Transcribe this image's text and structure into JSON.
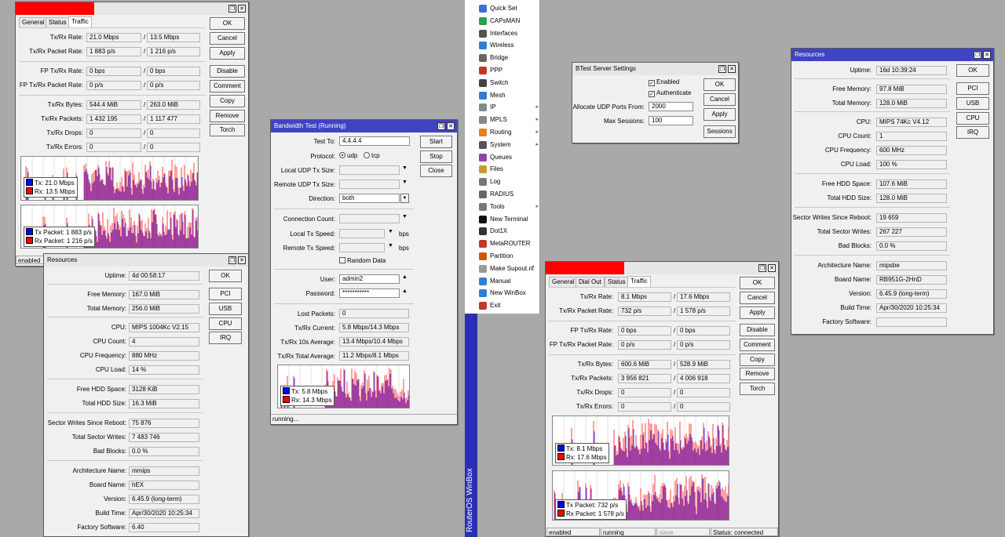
{
  "traffic1": {
    "tabs": [
      "General",
      "Status",
      "Traffic"
    ],
    "rows": [
      {
        "label": "Tx/Rx Rate:",
        "a": "21.0 Mbps",
        "b": "13.5 Mbps"
      },
      {
        "label": "Tx/Rx Packet Rate:",
        "a": "1 883 p/s",
        "b": "1 216 p/s"
      },
      {
        "label": "FP Tx/Rx Rate:",
        "a": "0 bps",
        "b": "0 bps"
      },
      {
        "label": "FP Tx/Rx Packet Rate:",
        "a": "0 p/s",
        "b": "0 p/s"
      },
      {
        "label": "Tx/Rx Bytes:",
        "a": "544.4 MiB",
        "b": "263.0 MiB"
      },
      {
        "label": "Tx/Rx Packets:",
        "a": "1 432 195",
        "b": "1 117 477"
      },
      {
        "label": "Tx/Rx Drops:",
        "a": "0",
        "b": "0"
      },
      {
        "label": "Tx/Rx Errors:",
        "a": "0",
        "b": "0"
      }
    ],
    "buttons": [
      "OK",
      "Cancel",
      "Apply",
      "Disable",
      "Comment",
      "Copy",
      "Remove",
      "Torch"
    ],
    "legend_rate": [
      "Tx:  21.0 Mbps",
      "Rx:  13.5 Mbps"
    ],
    "legend_pkt": [
      "Tx Packet:  1 883 p/s",
      "Rx Packet:  1 216 p/s"
    ],
    "status": "enabled"
  },
  "res1": {
    "title": "Resources",
    "fields": [
      {
        "label": "Uptime:",
        "value": "4d 00:58:17"
      },
      {
        "label": "Free Memory:",
        "value": "167.0 MiB"
      },
      {
        "label": "Total Memory:",
        "value": "256.0 MiB"
      },
      {
        "label": "CPU:",
        "value": "MIPS 1004Kc V2.15"
      },
      {
        "label": "CPU Count:",
        "value": "4"
      },
      {
        "label": "CPU Frequency:",
        "value": "880 MHz"
      },
      {
        "label": "CPU Load:",
        "value": "14 %"
      },
      {
        "label": "Free HDD Space:",
        "value": "3128 KiB"
      },
      {
        "label": "Total HDD Size:",
        "value": "16.3 MiB"
      },
      {
        "label": "Sector Writes Since Reboot:",
        "value": "75 876"
      },
      {
        "label": "Total Sector Writes:",
        "value": "7 483 746"
      },
      {
        "label": "Bad Blocks:",
        "value": "0.0 %"
      },
      {
        "label": "Architecture Name:",
        "value": "mmips"
      },
      {
        "label": "Board Name:",
        "value": "hEX"
      },
      {
        "label": "Version:",
        "value": "6.45.9 (long-term)"
      },
      {
        "label": "Build Time:",
        "value": "Apr/30/2020 10:25:34"
      },
      {
        "label": "Factory Software:",
        "value": "6.40"
      }
    ],
    "buttons": [
      "OK",
      "PCI",
      "USB",
      "CPU",
      "IRQ"
    ]
  },
  "bw": {
    "title": "Bandwidth Test (Running)",
    "test_to_label": "Test To:",
    "test_to": "4.4.4.4",
    "protocol_label": "Protocol:",
    "udp": "udp",
    "tcp": "tcp",
    "local_udp_label": "Local UDP Tx Size:",
    "remote_udp_label": "Remote UDP Tx Size:",
    "direction_label": "Direction:",
    "direction": "both",
    "conn_count_label": "Connection Count:",
    "local_tx_label": "Local Tx Speed:",
    "remote_tx_label": "Remote Tx Speed:",
    "unit": "bps",
    "random_label": "Random Data",
    "user_label": "User:",
    "user": "admin2",
    "password_label": "Password:",
    "password": "***********",
    "lost_label": "Lost Packets:",
    "lost": "0",
    "current_label": "Tx/Rx Current:",
    "current": "5.8 Mbps/14.3 Mbps",
    "avg10_label": "Tx/Rx 10s Average:",
    "avg10": "13.4 Mbps/10.4 Mbps",
    "total_label": "Tx/Rx Total Average:",
    "total": "11.2 Mbps/8.1 Mbps",
    "buttons": [
      "Start",
      "Stop",
      "Close"
    ],
    "legend": [
      "Tx:  5.8 Mbps",
      "Rx:  14.3 Mbps"
    ],
    "status": "running..."
  },
  "menu": {
    "items": [
      {
        "label": "Quick Set",
        "icon": "quick-set-icon",
        "sub": false
      },
      {
        "label": "CAPsMAN",
        "icon": "capsman-icon",
        "sub": false
      },
      {
        "label": "Interfaces",
        "icon": "interfaces-icon",
        "sub": false
      },
      {
        "label": "Wireless",
        "icon": "wireless-icon",
        "sub": false
      },
      {
        "label": "Bridge",
        "icon": "bridge-icon",
        "sub": false
      },
      {
        "label": "PPP",
        "icon": "ppp-icon",
        "sub": false
      },
      {
        "label": "Switch",
        "icon": "switch-icon",
        "sub": false
      },
      {
        "label": "Mesh",
        "icon": "mesh-icon",
        "sub": false
      },
      {
        "label": "IP",
        "icon": "ip-icon",
        "sub": true
      },
      {
        "label": "MPLS",
        "icon": "mpls-icon",
        "sub": true
      },
      {
        "label": "Routing",
        "icon": "routing-icon",
        "sub": true
      },
      {
        "label": "System",
        "icon": "system-icon",
        "sub": true
      },
      {
        "label": "Queues",
        "icon": "queues-icon",
        "sub": false
      },
      {
        "label": "Files",
        "icon": "files-icon",
        "sub": false
      },
      {
        "label": "Log",
        "icon": "log-icon",
        "sub": false
      },
      {
        "label": "RADIUS",
        "icon": "radius-icon",
        "sub": false
      },
      {
        "label": "Tools",
        "icon": "tools-icon",
        "sub": true
      },
      {
        "label": "New Terminal",
        "icon": "terminal-icon",
        "sub": false
      },
      {
        "label": "Dot1X",
        "icon": "dot1x-icon",
        "sub": false
      },
      {
        "label": "MetaROUTER",
        "icon": "metarouter-icon",
        "sub": false
      },
      {
        "label": "Partition",
        "icon": "partition-icon",
        "sub": false
      },
      {
        "label": "Make Supout.rif",
        "icon": "supout-icon",
        "sub": false
      },
      {
        "label": "Manual",
        "icon": "manual-icon",
        "sub": false
      },
      {
        "label": "New WinBox",
        "icon": "winbox-icon",
        "sub": false
      },
      {
        "label": "Exit",
        "icon": "exit-icon",
        "sub": false
      }
    ],
    "brand": "RouterOS WinBox"
  },
  "btest": {
    "title": "BTest Server Settings",
    "enabled": "Enabled",
    "authenticate": "Authenticate",
    "ports_label": "Allocate UDP Ports From:",
    "ports": "2000",
    "sessions_label": "Max Sessions:",
    "sessions": "100",
    "buttons": [
      "OK",
      "Cancel",
      "Apply",
      "Sessions"
    ]
  },
  "res2": {
    "title": "Resources",
    "fields": [
      {
        "label": "Uptime:",
        "value": "16d 10:39:24"
      },
      {
        "label": "Free Memory:",
        "value": "97.8 MiB"
      },
      {
        "label": "Total Memory:",
        "value": "128.0 MiB"
      },
      {
        "label": "CPU:",
        "value": "MIPS 74Kc V4.12"
      },
      {
        "label": "CPU Count:",
        "value": "1"
      },
      {
        "label": "CPU Frequency:",
        "value": "600 MHz"
      },
      {
        "label": "CPU Load:",
        "value": "100 %"
      },
      {
        "label": "Free HDD Space:",
        "value": "107.6 MiB"
      },
      {
        "label": "Total HDD Size:",
        "value": "128.0 MiB"
      },
      {
        "label": "Sector Writes Since Reboot:",
        "value": "19 659"
      },
      {
        "label": "Total Sector Writes:",
        "value": "267 227"
      },
      {
        "label": "Bad Blocks:",
        "value": "0.0 %"
      },
      {
        "label": "Architecture Name:",
        "value": "mipsbe"
      },
      {
        "label": "Board Name:",
        "value": "RB951G-2HnD"
      },
      {
        "label": "Version:",
        "value": "6.45.9 (long-term)"
      },
      {
        "label": "Build Time:",
        "value": "Apr/30/2020 10:25:34"
      },
      {
        "label": "Factory Software:",
        "value": ""
      }
    ],
    "buttons": [
      "OK",
      "PCI",
      "USB",
      "CPU",
      "IRQ"
    ]
  },
  "traffic2": {
    "tabs": [
      "General",
      "Dial Out",
      "Status",
      "Traffic"
    ],
    "rows": [
      {
        "label": "Tx/Rx Rate:",
        "a": "8.1 Mbps",
        "b": "17.6 Mbps"
      },
      {
        "label": "Tx/Rx Packet Rate:",
        "a": "732 p/s",
        "b": "1 578 p/s"
      },
      {
        "label": "FP Tx/Rx Rate:",
        "a": "0 bps",
        "b": "0 bps"
      },
      {
        "label": "FP Tx/Rx Packet Rate:",
        "a": "0 p/s",
        "b": "0 p/s"
      },
      {
        "label": "Tx/Rx Bytes:",
        "a": "600.6 MiB",
        "b": "528.9 MiB"
      },
      {
        "label": "Tx/Rx Packets:",
        "a": "3 956 821",
        "b": "4 006 918"
      },
      {
        "label": "Tx/Rx Drops:",
        "a": "0",
        "b": "0"
      },
      {
        "label": "Tx/Rx Errors:",
        "a": "0",
        "b": "0"
      }
    ],
    "buttons": [
      "OK",
      "Cancel",
      "Apply",
      "Disable",
      "Comment",
      "Copy",
      "Remove",
      "Torch"
    ],
    "legend_rate": [
      "Tx:  8.1 Mbps",
      "Rx:  17.6 Mbps"
    ],
    "legend_pkt": [
      "Tx Packet:  732 p/s",
      "Rx Packet:  1 578 p/s"
    ],
    "status": [
      "enabled",
      "running",
      "slave",
      "Status: connected"
    ]
  },
  "colors": {
    "tx": "#0000ff",
    "rx": "#ff0000",
    "titlebar_active": "#3f44c3",
    "menu_strip": "#2b2fb5"
  }
}
